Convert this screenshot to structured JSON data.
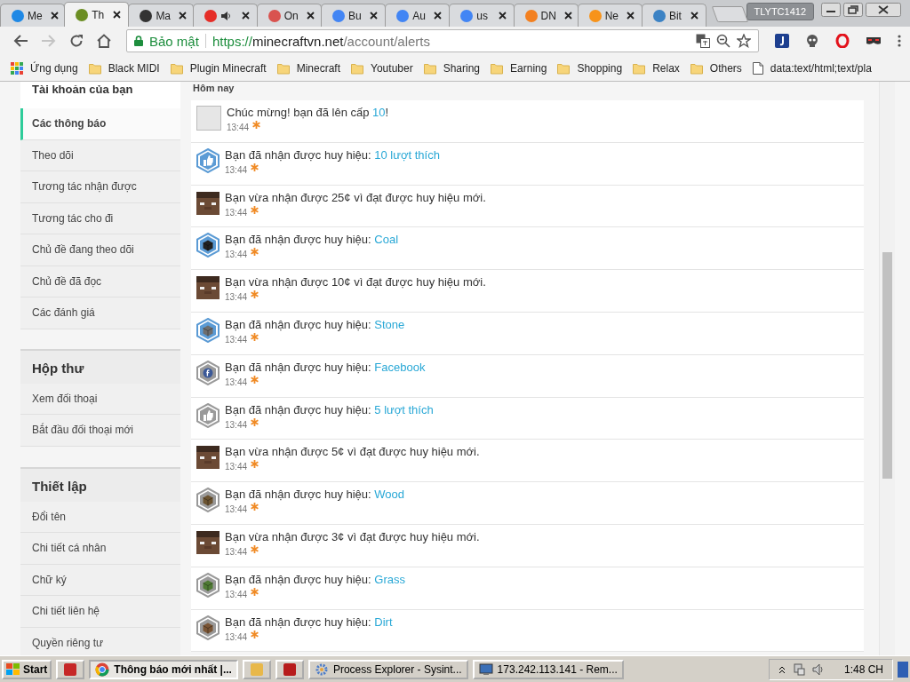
{
  "browser": {
    "tabs": [
      {
        "title": "Me",
        "selected": false,
        "color": "#1e88e5",
        "audio": false
      },
      {
        "title": "Th",
        "selected": true,
        "color": "#6b8e23",
        "audio": false
      },
      {
        "title": "Ma",
        "selected": false,
        "color": "#333333",
        "audio": false
      },
      {
        "selected": false,
        "color": "#e52d27",
        "audio": true
      },
      {
        "title": "On",
        "selected": false,
        "color": "#d9534f",
        "audio": false
      },
      {
        "title": "Bu",
        "selected": false,
        "color": "#4285f4",
        "audio": false
      },
      {
        "title": "Au",
        "selected": false,
        "color": "#4285f4",
        "audio": false
      },
      {
        "title": "us",
        "selected": false,
        "color": "#4285f4",
        "audio": false
      },
      {
        "title": "DN",
        "selected": false,
        "color": "#f38020",
        "audio": false
      },
      {
        "title": "Ne",
        "selected": false,
        "color": "#f7931a",
        "audio": false
      },
      {
        "title": "Bit",
        "selected": false,
        "color": "#3b82c4",
        "audio": false
      }
    ],
    "profile": "TLYTC1412",
    "security": "Bảo mật",
    "url_scheme": "https://",
    "url_host": "minecraftvn.net",
    "url_path": "/account/alerts",
    "bookmarks": [
      {
        "kind": "apps",
        "label": "Ứng dụng"
      },
      {
        "kind": "folder",
        "label": "Black MIDI"
      },
      {
        "kind": "folder",
        "label": "Plugin Minecraft"
      },
      {
        "kind": "folder",
        "label": "Minecraft"
      },
      {
        "kind": "folder",
        "label": "Youtuber"
      },
      {
        "kind": "folder",
        "label": "Sharing"
      },
      {
        "kind": "folder",
        "label": "Earning"
      },
      {
        "kind": "folder",
        "label": "Shopping"
      },
      {
        "kind": "folder",
        "label": "Relax"
      },
      {
        "kind": "folder",
        "label": "Others"
      },
      {
        "kind": "page",
        "label": "data:text/html;text/pla"
      }
    ]
  },
  "sidebar": {
    "sections": [
      {
        "title": "Tài khoản của bạn",
        "items": [
          {
            "label": "Các thông báo",
            "selected": true
          },
          {
            "label": "Theo dõi",
            "selected": false
          },
          {
            "label": "Tương tác nhận được",
            "selected": false
          },
          {
            "label": "Tương tác cho đi",
            "selected": false
          },
          {
            "label": "Chủ đề đang theo dõi",
            "selected": false
          },
          {
            "label": "Chủ đề đã đọc",
            "selected": false
          },
          {
            "label": "Các đánh giá",
            "selected": false
          }
        ]
      },
      {
        "title": "Hộp thư",
        "items": [
          {
            "label": "Xem đối thoại",
            "selected": false
          },
          {
            "label": "Bắt đầu đối thoại mới",
            "selected": false
          }
        ]
      },
      {
        "title": "Thiết lập",
        "items": [
          {
            "label": "Đổi tên",
            "selected": false
          },
          {
            "label": "Chi tiết cá nhân",
            "selected": false
          },
          {
            "label": "Chữ ký",
            "selected": false
          },
          {
            "label": "Chi tiết liên hệ",
            "selected": false
          },
          {
            "label": "Quyền riêng tư",
            "selected": false
          }
        ]
      }
    ]
  },
  "alerts": {
    "heading": "Hôm nay",
    "items": [
      {
        "kind": "photo",
        "text": "Chúc mừng! bạn đã lên cấp ",
        "link": "10",
        "after": "!",
        "time": "13:44"
      },
      {
        "kind": "like",
        "color": "#5b9bd5",
        "text": "Bạn đã nhận được huy hiệu: ",
        "link": "10 lượt thích",
        "time": "13:44"
      },
      {
        "kind": "head",
        "text": "Bạn vừa nhận được 25¢ vì đạt được huy hiệu mới.",
        "time": "13:44"
      },
      {
        "kind": "block",
        "color": "#5b9bd5",
        "text": "Bạn đã nhận được huy hiệu: ",
        "link": "Coal",
        "time": "13:44"
      },
      {
        "kind": "head",
        "text": "Bạn vừa nhận được 10¢ vì đạt được huy hiệu mới.",
        "time": "13:44"
      },
      {
        "kind": "block",
        "color": "#5b9bd5",
        "text": "Bạn đã nhận được huy hiệu: ",
        "link": "Stone",
        "time": "13:44"
      },
      {
        "kind": "facebook",
        "color": "#9a9a9a",
        "text": "Bạn đã nhận được huy hiệu: ",
        "link": "Facebook",
        "time": "13:44"
      },
      {
        "kind": "like",
        "color": "#9a9a9a",
        "text": "Bạn đã nhận được huy hiệu: ",
        "link": "5 lượt thích",
        "time": "13:44"
      },
      {
        "kind": "head",
        "text": "Bạn vừa nhận được 5¢ vì đạt được huy hiệu mới.",
        "time": "13:44"
      },
      {
        "kind": "block",
        "color": "#9a9a9a",
        "text": "Bạn đã nhận được huy hiệu: ",
        "link": "Wood",
        "time": "13:44"
      },
      {
        "kind": "head",
        "text": "Bạn vừa nhận được 3¢ vì đạt được huy hiệu mới.",
        "time": "13:44"
      },
      {
        "kind": "block",
        "color": "#9a9a9a",
        "text": "Bạn đã nhận được huy hiệu: ",
        "link": "Grass",
        "time": "13:44"
      },
      {
        "kind": "block",
        "color": "#9a9a9a",
        "text": "Bạn đã nhận được huy hiệu: ",
        "link": "Dirt",
        "time": "13:44"
      }
    ]
  },
  "taskbar": {
    "start": "Start",
    "tasks": [
      {
        "kind": "icon",
        "color": "#c62828",
        "selected": false
      },
      {
        "kind": "window",
        "label": "Thông báo mới nhất |...",
        "selected": true
      },
      {
        "kind": "icon",
        "color": "#e8b84a",
        "selected": false
      },
      {
        "kind": "icon",
        "color": "#b71c1c",
        "selected": false
      },
      {
        "kind": "window",
        "label": "Process Explorer - Sysint...",
        "selected": false
      },
      {
        "kind": "window",
        "label": "173.242.113.141 - Rem...",
        "selected": false
      }
    ],
    "clock": "1:48 CH"
  }
}
